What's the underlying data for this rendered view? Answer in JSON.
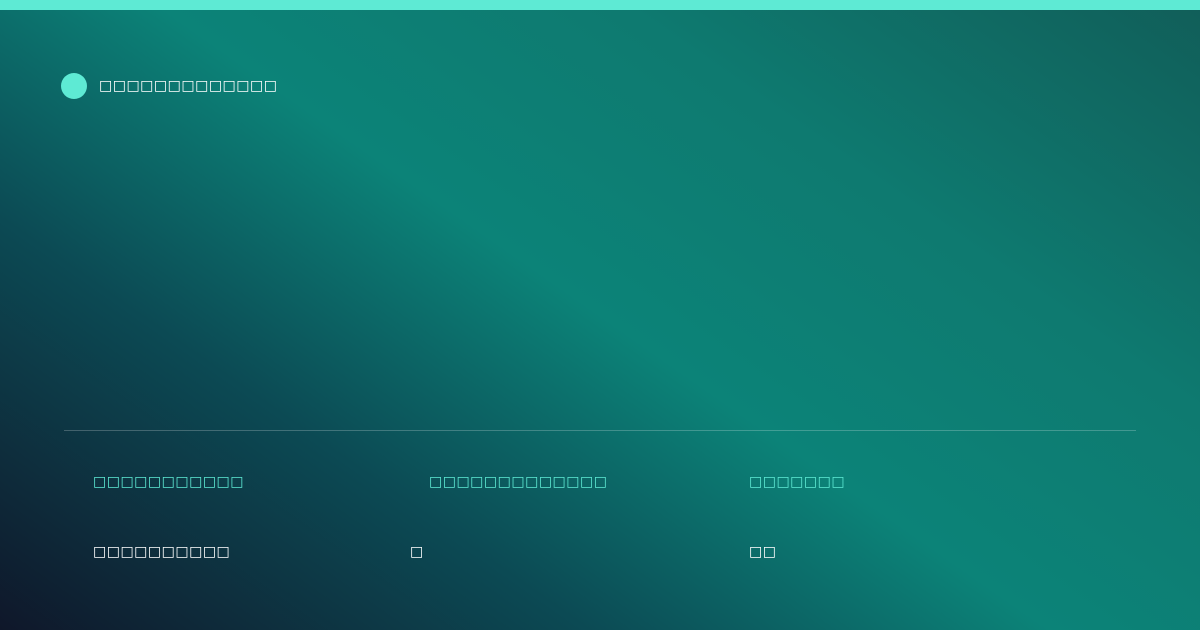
{
  "brand": {
    "name": "□□□□□□□□□□□□□"
  },
  "stats": [
    {
      "label": "□□□□□□□□□□□",
      "value": "□□□□□□□□□□"
    },
    {
      "label": "□□□□□□□□□□□□□",
      "value": "□"
    },
    {
      "label": "□□□□□□□",
      "value": "□□"
    }
  ],
  "colors": {
    "accent": "#5eead4",
    "gradient_start": "#0f172a",
    "gradient_mid": "#0c8378",
    "gradient_end": "#115e59",
    "text": "#ffffff"
  }
}
